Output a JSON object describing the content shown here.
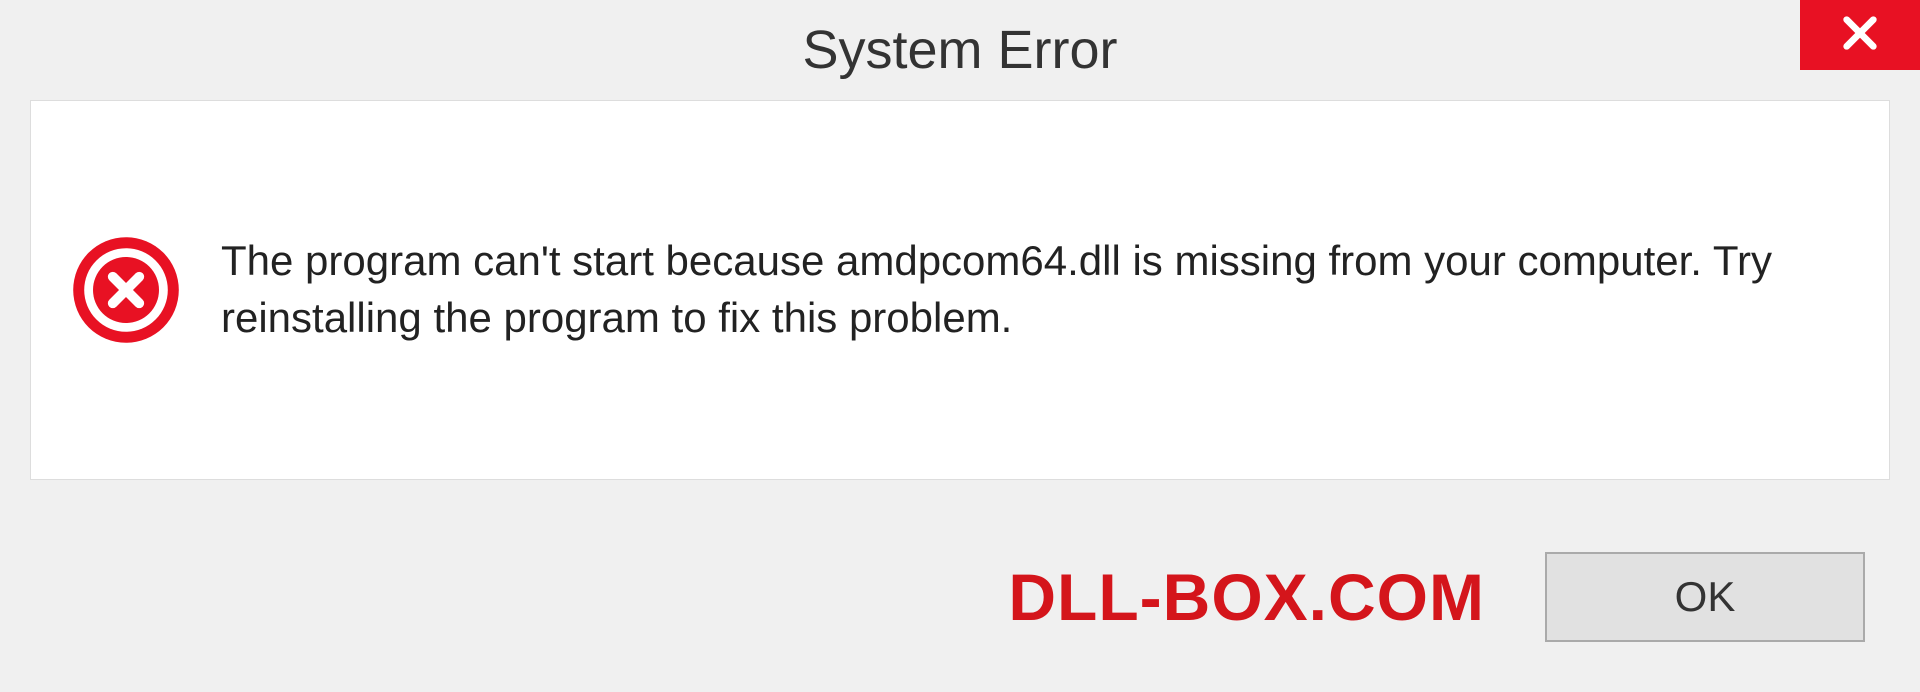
{
  "dialog": {
    "title": "System Error",
    "message": "The program can't start because amdpcom64.dll is missing from your computer. Try reinstalling the program to fix this problem.",
    "ok_label": "OK"
  },
  "watermark": "DLL-BOX.COM",
  "colors": {
    "close_bg": "#e81123",
    "error_icon": "#e81123",
    "watermark": "#d4151b"
  }
}
